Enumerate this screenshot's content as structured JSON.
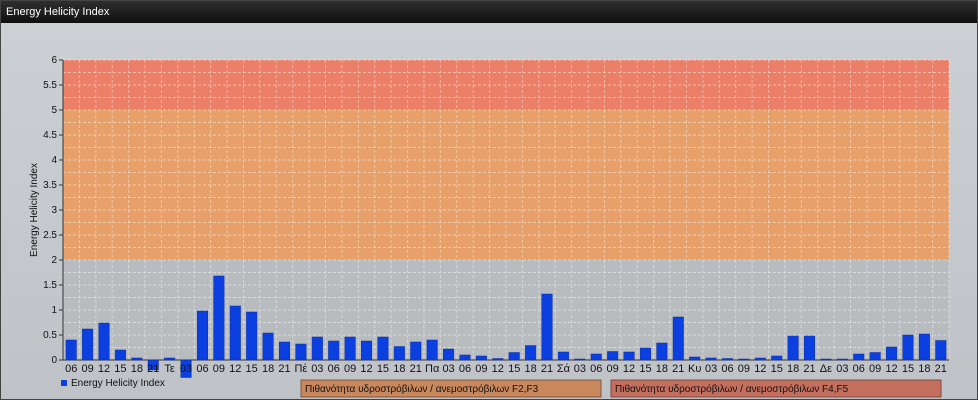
{
  "window": {
    "title": "Energy Helicity Index"
  },
  "chart_data": {
    "type": "bar",
    "title": "",
    "ylabel": "Energy Helicity Index",
    "xlabel": "",
    "ylim": [
      0,
      6
    ],
    "y_ticks": [
      "0",
      "0.5",
      "1",
      "1.5",
      "2",
      "2.5",
      "3",
      "3.5",
      "4",
      "4.5",
      "5",
      "5.5",
      "6"
    ],
    "grid": true,
    "bar_color": "#0b3fe0",
    "zones": [
      {
        "from": 0,
        "to": 2,
        "color": "#b9bcbf"
      },
      {
        "from": 2,
        "to": 5,
        "color": "#e8a06a"
      },
      {
        "from": 5,
        "to": 6,
        "color": "#ec7f68"
      }
    ],
    "categories": [
      "06",
      "09",
      "12",
      "15",
      "18",
      "21",
      "Τε",
      "03",
      "06",
      "09",
      "12",
      "15",
      "18",
      "21",
      "Πέ",
      "03",
      "06",
      "09",
      "12",
      "15",
      "18",
      "21",
      "Πα",
      "03",
      "06",
      "09",
      "12",
      "15",
      "18",
      "21",
      "Σά",
      "03",
      "06",
      "09",
      "12",
      "15",
      "18",
      "21",
      "Κυ",
      "03",
      "06",
      "09",
      "12",
      "15",
      "18",
      "21",
      "Δε",
      "03",
      "06",
      "09",
      "12",
      "15",
      "18",
      "21"
    ],
    "series": [
      {
        "name": "Energy Helicity Index",
        "values": [
          0.4,
          0.62,
          0.74,
          0.2,
          0.04,
          -0.2,
          0.04,
          -0.35,
          0.98,
          1.68,
          1.08,
          0.96,
          0.54,
          0.36,
          0.32,
          0.46,
          0.38,
          0.46,
          0.38,
          0.46,
          0.27,
          0.36,
          0.4,
          0.22,
          0.1,
          0.08,
          0.03,
          0.15,
          0.29,
          1.32,
          0.16,
          0.02,
          0.12,
          0.17,
          0.16,
          0.24,
          0.34,
          0.86,
          0.06,
          0.04,
          0.03,
          0.02,
          0.04,
          0.08,
          0.48,
          0.48,
          0.02,
          0.02,
          0.12,
          0.15,
          0.26,
          0.5,
          0.52,
          0.39
        ]
      }
    ],
    "legend": {
      "position": "bottom-left",
      "items": [
        {
          "label": "Energy Helicity Index",
          "color": "#0b3fe0"
        },
        {
          "label": "Πιθανότητα υδροστρόβιλων / ανεμοστρόβιλων F2,F3",
          "color": "#c9875c"
        },
        {
          "label": "Πιθανότητα υδροστρόβιλων / ανεμοστρόβιλων F4,F5",
          "color": "#c46e5e"
        }
      ]
    }
  }
}
